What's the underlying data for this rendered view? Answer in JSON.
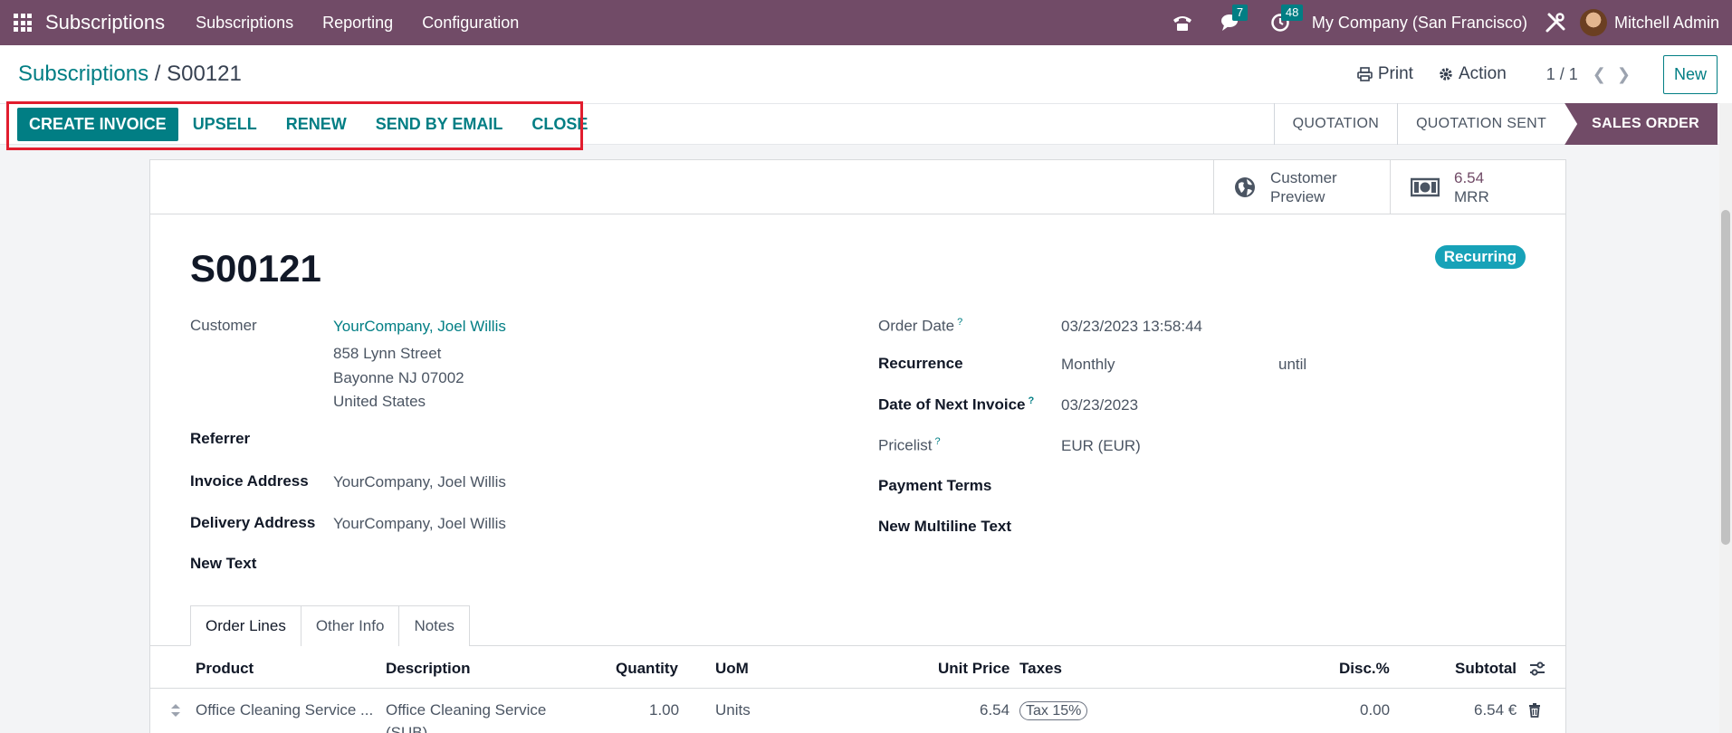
{
  "navbar": {
    "brand": "Subscriptions",
    "menus": [
      "Subscriptions",
      "Reporting",
      "Configuration"
    ],
    "chat_count": "7",
    "activity_count": "48",
    "company": "My Company (San Francisco)",
    "user": "Mitchell Admin"
  },
  "breadcrumb": {
    "parent": "Subscriptions",
    "sep": "/",
    "current": "S00121"
  },
  "control": {
    "print": "Print",
    "action": "Action",
    "pager": "1 / 1",
    "new": "New"
  },
  "actions": {
    "create_invoice": "CREATE INVOICE",
    "upsell": "UPSELL",
    "renew": "RENEW",
    "send_email": "SEND BY EMAIL",
    "close": "CLOSE"
  },
  "stages": [
    "QUOTATION",
    "QUOTATION SENT",
    "SALES ORDER"
  ],
  "smart_buttons": {
    "preview_l1": "Customer",
    "preview_l2": "Preview",
    "mrr_value": "6.54",
    "mrr_label": "MRR"
  },
  "record": {
    "name": "S00121",
    "tag": "Recurring",
    "customer_label": "Customer",
    "customer": "YourCompany, Joel Willis",
    "address1": "858 Lynn Street",
    "address2": "Bayonne NJ 07002",
    "address3": "United States",
    "referrer_label": "Referrer",
    "invoice_address_label": "Invoice Address",
    "invoice_address": "YourCompany, Joel Willis",
    "delivery_address_label": "Delivery Address",
    "delivery_address": "YourCompany, Joel Willis",
    "new_text_label": "New Text",
    "order_date_label": "Order Date",
    "order_date": "03/23/2023 13:58:44",
    "recurrence_label": "Recurrence",
    "recurrence": "Monthly",
    "until": "until",
    "next_invoice_label": "Date of Next Invoice",
    "next_invoice": "03/23/2023",
    "pricelist_label": "Pricelist",
    "pricelist": "EUR (EUR)",
    "payment_terms_label": "Payment Terms",
    "multiline_label": "New Multiline Text",
    "help": "?"
  },
  "tabs": [
    "Order Lines",
    "Other Info",
    "Notes"
  ],
  "table": {
    "headers": {
      "product": "Product",
      "description": "Description",
      "quantity": "Quantity",
      "uom": "UoM",
      "unit_price": "Unit Price",
      "taxes": "Taxes",
      "disc": "Disc.%",
      "subtotal": "Subtotal"
    },
    "rows": [
      {
        "product": "Office Cleaning Service ...",
        "description": "Office Cleaning Service",
        "description2": "(SUB)",
        "quantity": "1.00",
        "uom": "Units",
        "unit_price": "6.54",
        "tax": "Tax 15%",
        "disc": "0.00",
        "subtotal": "6.54 €"
      }
    ]
  },
  "colors": {
    "brand": "#714b67",
    "accent": "#017e84",
    "highlight": "#e11d2e"
  }
}
